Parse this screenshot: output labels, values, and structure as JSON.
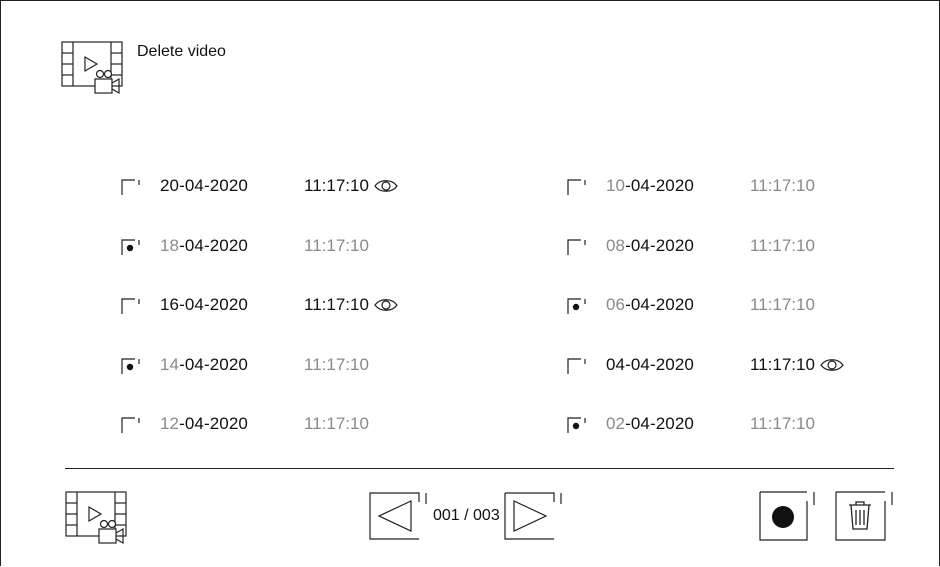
{
  "header": {
    "title": "Delete video",
    "icon": "video-folder-icon"
  },
  "list": {
    "left": [
      {
        "day": "20",
        "rest": "-04-2020",
        "time": "11:17:10",
        "selected": false,
        "day_dim": false,
        "time_dim": false,
        "viewed": true
      },
      {
        "day": "18",
        "rest": "-04-2020",
        "time": "11:17:10",
        "selected": true,
        "day_dim": true,
        "time_dim": true,
        "viewed": false
      },
      {
        "day": "16",
        "rest": "-04-2020",
        "time": "11:17:10",
        "selected": false,
        "day_dim": false,
        "time_dim": false,
        "viewed": true
      },
      {
        "day": "14",
        "rest": "-04-2020",
        "time": "11:17:10",
        "selected": true,
        "day_dim": true,
        "time_dim": true,
        "viewed": false
      },
      {
        "day": "12",
        "rest": "-04-2020",
        "time": "11:17:10",
        "selected": false,
        "day_dim": true,
        "time_dim": true,
        "viewed": false
      }
    ],
    "right": [
      {
        "day": "10",
        "rest": "-04-2020",
        "time": "11:17:10",
        "selected": false,
        "day_dim": true,
        "time_dim": true,
        "viewed": false
      },
      {
        "day": "08",
        "rest": "-04-2020",
        "time": "11:17:10",
        "selected": false,
        "day_dim": true,
        "time_dim": true,
        "viewed": false
      },
      {
        "day": "06",
        "rest": "-04-2020",
        "time": "11:17:10",
        "selected": true,
        "day_dim": true,
        "time_dim": true,
        "viewed": false
      },
      {
        "day": "04",
        "rest": "-04-2020",
        "time": "11:17:10",
        "selected": false,
        "day_dim": false,
        "time_dim": false,
        "viewed": true
      },
      {
        "day": "02",
        "rest": "-04-2020",
        "time": "11:17:10",
        "selected": true,
        "day_dim": true,
        "time_dim": true,
        "viewed": false
      }
    ]
  },
  "footer": {
    "page_label": "001 / 003",
    "icons": {
      "home": "video-folder-icon",
      "prev": "triangle-left-icon",
      "next": "triangle-right-icon",
      "record": "record-dot-icon",
      "delete": "trash-icon"
    }
  },
  "colors": {
    "text": "#111111",
    "dim": "#8a8a8a",
    "line": "#222222",
    "background": "#ffffff"
  }
}
